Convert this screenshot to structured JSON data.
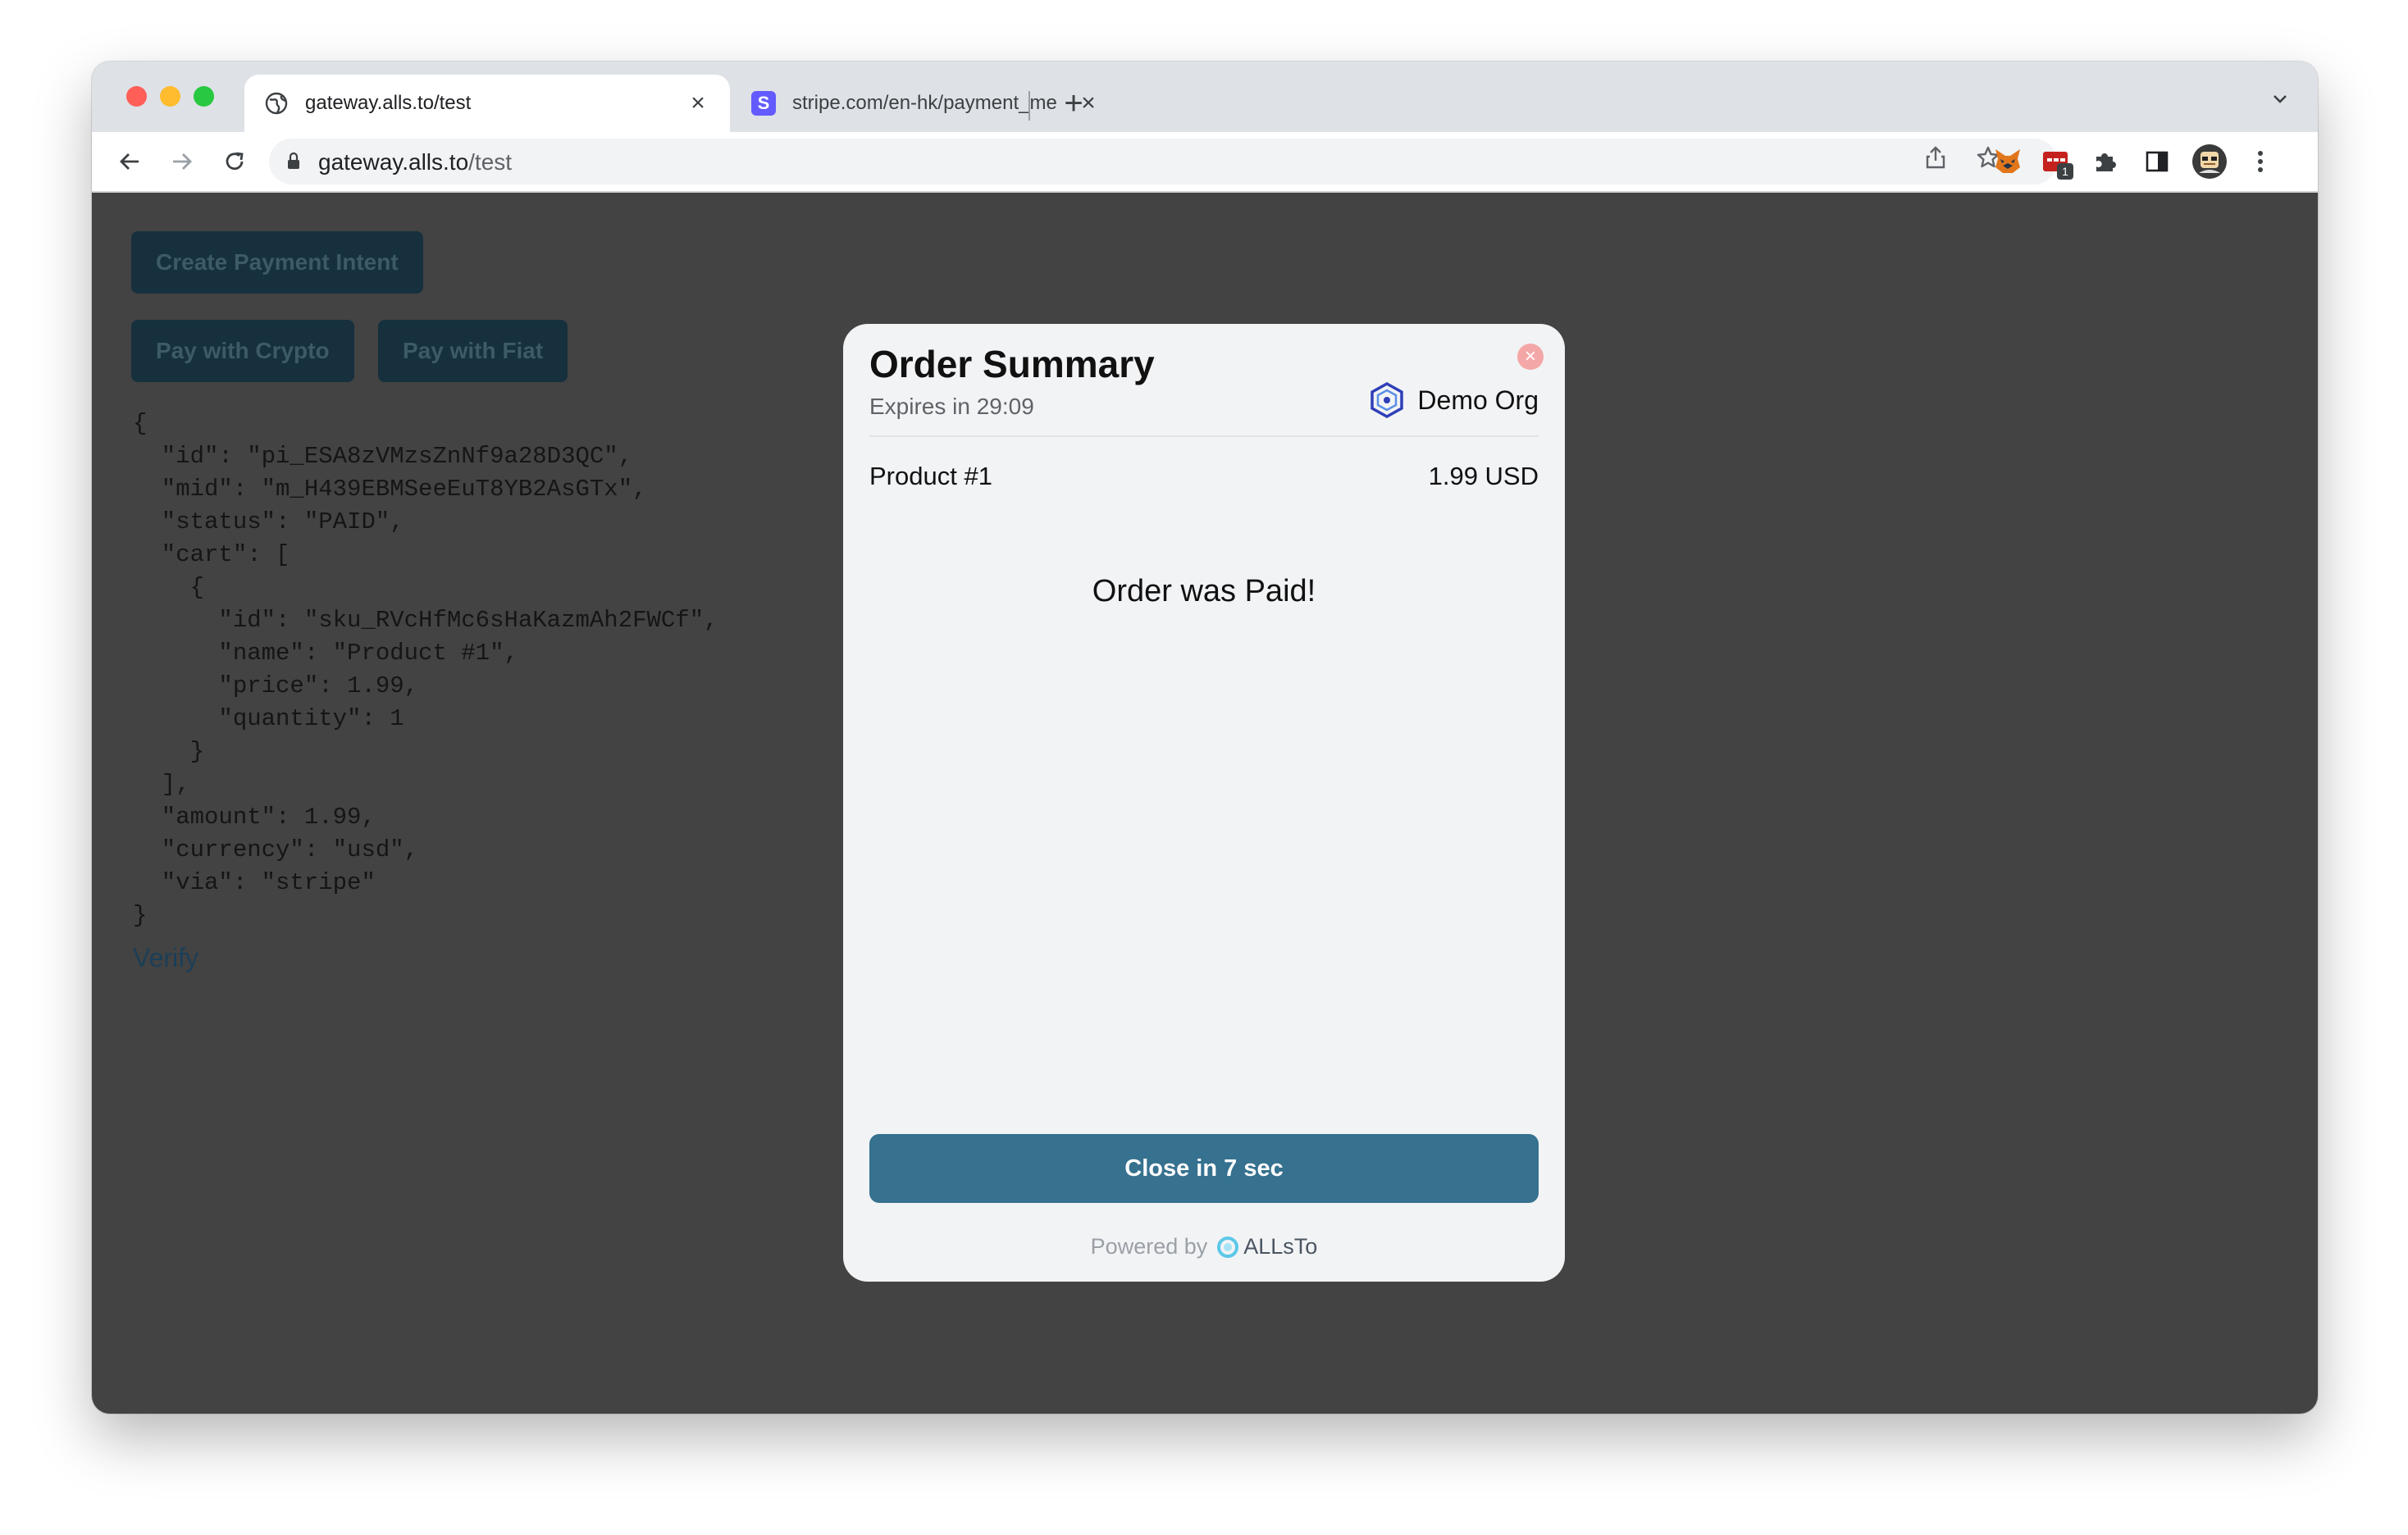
{
  "browser": {
    "tabs": [
      {
        "title": "gateway.alls.to/test",
        "favicon": "globe-icon",
        "active": true
      },
      {
        "title": "stripe.com/en-hk/payment_me",
        "favicon": "stripe-icon",
        "favicon_letter": "S",
        "active": false
      }
    ],
    "new_tab_label": "+",
    "address": {
      "host": "gateway.alls.to",
      "path": "/test"
    },
    "extension_badge": "1"
  },
  "page": {
    "create_button": "Create Payment Intent",
    "pay_crypto_button": "Pay with Crypto",
    "pay_fiat_button": "Pay with Fiat",
    "json_lines": [
      "{",
      "  \"id\": \"pi_ESA8zVMzsZnNf9a28D3QC\",",
      "  \"mid\": \"m_H439EBMSeeEuT8YB2AsGTx\",",
      "  \"status\": \"PAID\",",
      "  \"cart\": [",
      "    {",
      "      \"id\": \"sku_RVcHfMc6sHaKazmAh2FWCf\",",
      "      \"name\": \"Product #1\",",
      "      \"price\": 1.99,",
      "      \"quantity\": 1",
      "    }",
      "  ],",
      "  \"amount\": 1.99,",
      "  \"currency\": \"usd\",",
      "  \"via\": \"stripe\"",
      "}"
    ],
    "verify_link": "Verify"
  },
  "modal": {
    "title": "Order Summary",
    "expires": "Expires in 29:09",
    "org_name": "Demo Org",
    "product_name": "Product #1",
    "product_price": "1.99 USD",
    "status_message": "Order was Paid!",
    "close_button": "Close in 7 sec",
    "powered_by": "Powered by",
    "brand": "ALLsTo",
    "close_icon": "×"
  },
  "colors": {
    "accent": "#36718f",
    "overlay_bg": "#434343",
    "dark_button": "#16303d",
    "close_circle": "#f4a7a7"
  }
}
